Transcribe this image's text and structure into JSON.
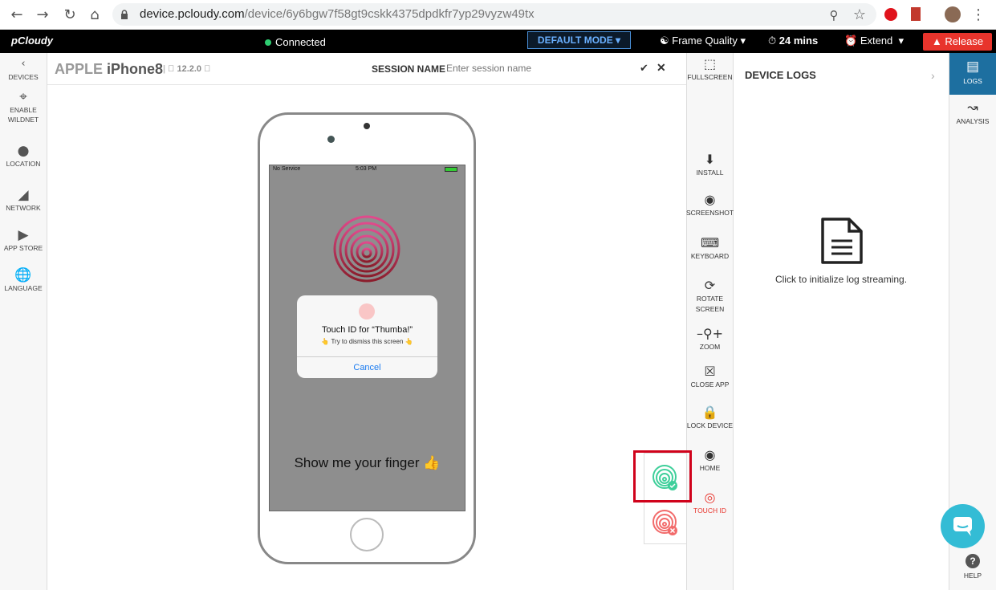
{
  "browser": {
    "url_host": "device.pcloudy.com",
    "url_path": "/device/6y6bgw7f58gt9cskk4375dpdkfr7yp29vyzw49tx"
  },
  "appbar": {
    "logo": "pCloudy",
    "status": "Connected",
    "mode": "DEFAULT MODE",
    "frame_quality": "Frame Quality",
    "timer": "24 mins",
    "extend": "Extend",
    "release": "Release"
  },
  "left_nav": [
    {
      "icon": "back-chevron-icon",
      "label": "DEVICES"
    },
    {
      "icon": "wifi-tower-icon",
      "label": "ENABLE WILDNET"
    },
    {
      "icon": "location-pin-icon",
      "label": "LOCATION"
    },
    {
      "icon": "signal-icon",
      "label": "NETWORK"
    },
    {
      "icon": "play-circle-icon",
      "label": "APP STORE"
    },
    {
      "icon": "globe-icon",
      "label": "LANGUAGE"
    }
  ],
  "device": {
    "brand": "APPLE",
    "model": "iPhone8",
    "os_version": "12.2.0"
  },
  "session": {
    "label": "SESSION NAME",
    "placeholder": "Enter session name"
  },
  "phone_screen": {
    "carrier": "No Service",
    "time": "5:03 PM",
    "alert_title": "Touch ID for “Thumba!”",
    "alert_sub": "👆 Try to dismiss this screen 👆",
    "alert_cancel": "Cancel",
    "message": "Show me your finger 👍"
  },
  "tools": [
    {
      "icon": "fullscreen-icon",
      "label": "FULLSCREEN"
    },
    {
      "icon": "install-icon",
      "label": "INSTALL"
    },
    {
      "icon": "camera-icon",
      "label": "SCREENSHOT"
    },
    {
      "icon": "keyboard-icon",
      "label": "KEYBOARD"
    },
    {
      "icon": "rotate-icon",
      "label": "ROTATE SCREEN"
    },
    {
      "icon": "zoom-icon",
      "label": "ZOOM"
    },
    {
      "icon": "close-app-icon",
      "label": "CLOSE APP"
    },
    {
      "icon": "lock-icon",
      "label": "LOCK DEVICE"
    },
    {
      "icon": "home-icon",
      "label": "HOME"
    },
    {
      "icon": "fingerprint-icon",
      "label": "TOUCH ID"
    }
  ],
  "logs": {
    "title": "DEVICE LOGS",
    "message": "Click to initialize log streaming."
  },
  "right_nav": {
    "logs": "LOGS",
    "analysis": "ANALYSIS",
    "help": "HELP"
  },
  "colors": {
    "accent": "#1d6fa0",
    "release": "#e8342c",
    "touch_success": "#3ecf9a",
    "touch_fail": "#f26b6b",
    "highlight": "#d0021b"
  }
}
